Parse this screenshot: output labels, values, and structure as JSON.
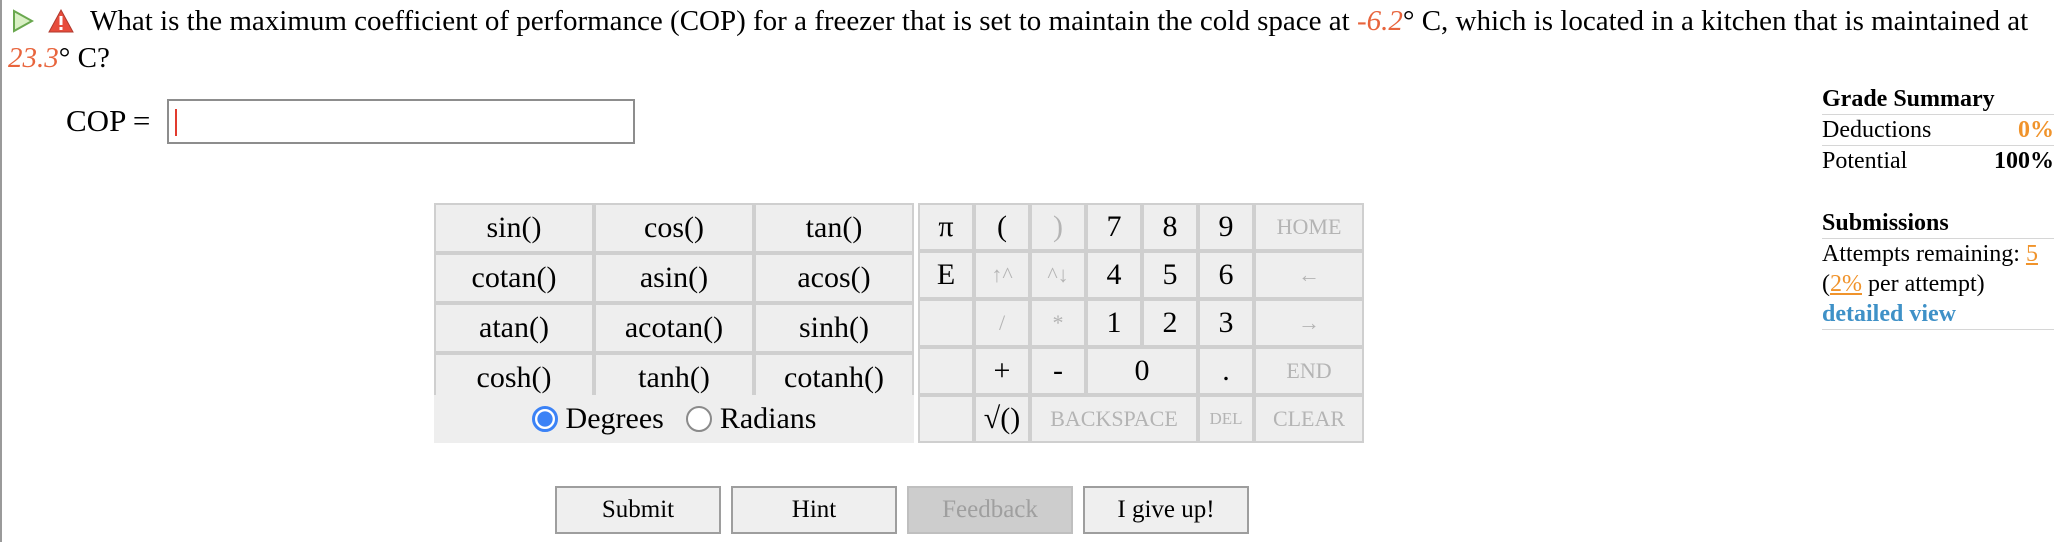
{
  "question": {
    "part1": "What is the maximum coefficient of performance (COP) for a freezer that is set to maintain the cold space at ",
    "cold_temp": "-6.2",
    "part2": "° C, which is located in a kitchen that is maintained at ",
    "kitchen_temp": "23.3",
    "part3": "° C?"
  },
  "answer": {
    "label": "COP =",
    "value": ""
  },
  "keypad": {
    "functions": [
      [
        "sin()",
        "cos()",
        "tan()"
      ],
      [
        "cotan()",
        "asin()",
        "acos()"
      ],
      [
        "atan()",
        "acotan()",
        "sinh()"
      ],
      [
        "cosh()",
        "tanh()",
        "cotanh()"
      ]
    ],
    "degrees_label": "Degrees",
    "radians_label": "Radians",
    "angle_mode": "Degrees",
    "pi": "π",
    "e": "E",
    "open_paren": "(",
    "close_paren": ")",
    "up_arrow": "↑^",
    "down_arrow": "^↓",
    "divide": "/",
    "multiply": "*",
    "plus": "+",
    "minus": "-",
    "sqrt": "√()",
    "digits": [
      "7",
      "8",
      "9",
      "4",
      "5",
      "6",
      "1",
      "2",
      "3",
      "0",
      "."
    ],
    "home": "HOME",
    "left": "←",
    "right": "→",
    "end": "END",
    "backspace": "BACKSPACE",
    "del": "DEL",
    "clear": "CLEAR"
  },
  "buttons": {
    "submit": "Submit",
    "hint": "Hint",
    "feedback": "Feedback",
    "give_up": "I give up!"
  },
  "grade_summary": {
    "title": "Grade Summary",
    "deductions_label": "Deductions",
    "deductions_value": "0%",
    "potential_label": "Potential",
    "potential_value": "100%"
  },
  "submissions": {
    "title": "Submissions",
    "attempts_label": "Attempts remaining: ",
    "attempts_value": "5",
    "per_open": "(",
    "per_value": "2%",
    "per_label": " per attempt)",
    "detailed_link": "detailed view"
  }
}
